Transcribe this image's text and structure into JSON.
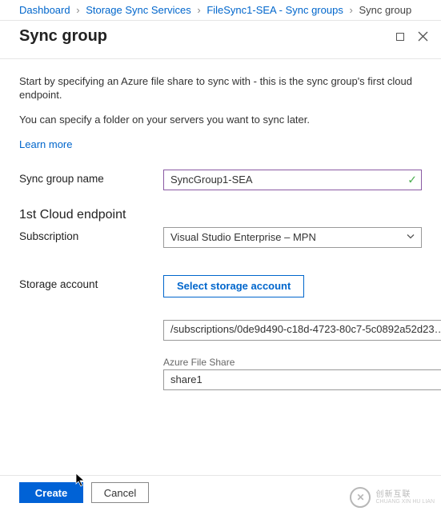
{
  "breadcrumbs": {
    "items": [
      {
        "label": "Dashboard"
      },
      {
        "label": "Storage Sync Services"
      },
      {
        "label": "FileSync1-SEA - Sync groups"
      }
    ],
    "current": "Sync group"
  },
  "header": {
    "title": "Sync group"
  },
  "body": {
    "intro1": "Start by specifying an Azure file share to sync with - this is the sync group's first cloud endpoint.",
    "intro2": "You can specify a folder on your servers you want to sync later.",
    "learnMore": "Learn more"
  },
  "form": {
    "syncGroup": {
      "label": "Sync group name",
      "value": "SyncGroup1-SEA"
    },
    "endpointHeading": "1st Cloud endpoint",
    "subscription": {
      "label": "Subscription",
      "value": "Visual Studio Enterprise – MPN"
    },
    "storageAccount": {
      "label": "Storage account",
      "selectBtn": "Select storage account",
      "value": "/subscriptions/0de9d490-c18d-4723-80c7-5c0892a52d23…"
    },
    "fileShare": {
      "label": "Azure File Share",
      "value": "share1"
    }
  },
  "footer": {
    "create": "Create",
    "cancel": "Cancel"
  },
  "watermark": {
    "brand": "创新互联",
    "sub": "CHUANG XIN HU LIAN"
  }
}
